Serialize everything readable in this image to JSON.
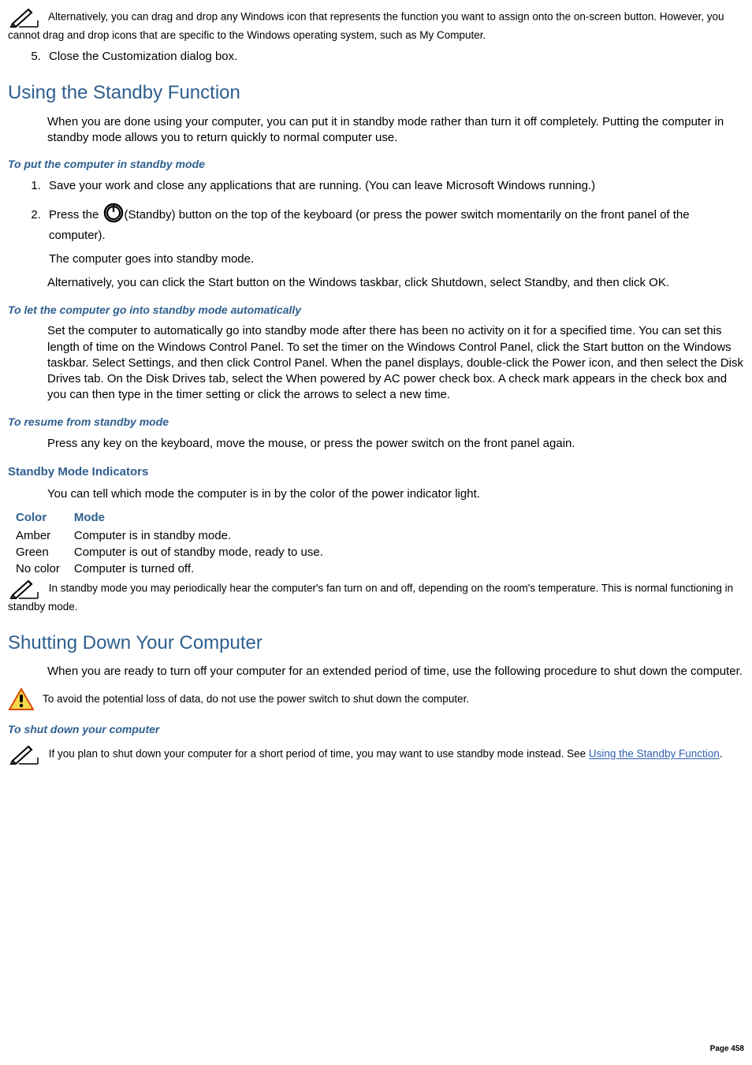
{
  "note1": "Alternatively, you can drag and drop any Windows icon that represents the function you want to assign onto the on-screen button. However, you cannot drag and drop icons that are specific to the Windows operating system, such as My Computer.",
  "step5": "Close the Customization dialog box.",
  "sec1_title": "Using the Standby Function",
  "sec1_intro": "When you are done using your computer, you can put it in standby mode rather than turn it off completely. Putting the computer in standby mode allows you to return quickly to normal computer use.",
  "h_put": "To put the computer in standby mode",
  "put_step1": "Save your work and close any applications that are running. (You can leave Microsoft Windows running.)",
  "put_step2a": "Press the ",
  "put_step2b": "(Standby) button on the top of the keyboard (or press the power switch momentarily on the front panel of the computer).",
  "put_result": "The computer goes into standby mode.",
  "put_alt": "Alternatively, you can click the Start button on the Windows taskbar, click Shutdown, select Standby, and then click OK.",
  "h_auto": "To let the computer go into standby mode automatically",
  "auto_text": "Set the computer to automatically go into standby mode after there has been no activity on it for a specified time. You can set this length of time on the Windows Control Panel. To set the timer on the Windows Control Panel, click the Start button on the Windows taskbar. Select Settings, and then click Control Panel. When the panel displays, double-click the Power icon, and then select the Disk Drives tab. On the Disk Drives tab, select the When powered by AC power check box. A check mark appears in the check box and you can then type in the timer setting or click the arrows to select a new time.",
  "h_resume": "To resume from standby mode",
  "resume_text": "Press any key on the keyboard, move the mouse, or press the power switch on the front panel again.",
  "h_indicators": "Standby Mode Indicators",
  "indicators_intro": "You can tell which mode the computer is in by the color of the power indicator light.",
  "table": {
    "h1": "Color",
    "h2": "Mode",
    "rows": [
      {
        "c": "Amber",
        "m": "Computer is in standby mode."
      },
      {
        "c": "Green",
        "m": "Computer is out of standby mode, ready to use."
      },
      {
        "c": "No color",
        "m": "Computer is turned off."
      }
    ]
  },
  "note2": "In standby mode you may periodically hear the computer's fan turn on and off, depending on the room's temperature. This is normal functioning in standby mode.",
  "sec2_title": "Shutting Down Your Computer",
  "sec2_intro": "When you are ready to turn off your computer for an extended period of time, use the following procedure to shut down the computer.",
  "warn_text": "To avoid the potential loss of data, do not use the power switch to shut down the computer.",
  "h_shutdown": "To shut down your computer",
  "note3a": "If you plan to shut down your computer for a short period of time, you may want to use standby mode instead. See ",
  "note3_link": "Using the Standby Function",
  "note3b": ".",
  "page_num": "Page 458"
}
